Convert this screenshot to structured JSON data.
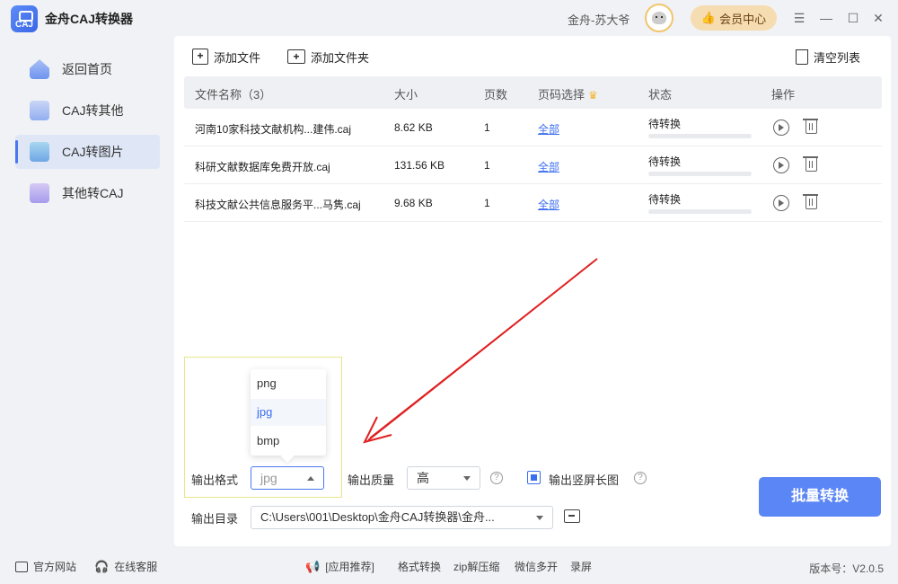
{
  "app": {
    "title": "金舟CAJ转换器",
    "logo_text": "CAJ",
    "username": "金舟-苏大爷",
    "vip_label": "会员中心"
  },
  "sidebar": {
    "items": [
      {
        "label": "返回首页",
        "icon": "home-icon"
      },
      {
        "label": "CAJ转其他",
        "icon": "caj-file-icon"
      },
      {
        "label": "CAJ转图片",
        "icon": "image-icon",
        "active": true
      },
      {
        "label": "其他转CAJ",
        "icon": "caj-convert-icon"
      }
    ]
  },
  "toolbar": {
    "add_file": "添加文件",
    "add_folder": "添加文件夹",
    "clear_list": "清空列表"
  },
  "table": {
    "headers": {
      "name": "文件名称（3）",
      "size": "大小",
      "pages": "页数",
      "page_select": "页码选择",
      "status": "状态",
      "actions": "操作"
    },
    "rows": [
      {
        "name": "河南10家科技文献机构...建伟.caj",
        "size": "8.62 KB",
        "pages": "1",
        "page_select": "全部",
        "status": "待转换"
      },
      {
        "name": "科研文献数据库免费开放.caj",
        "size": "131.56 KB",
        "pages": "1",
        "page_select": "全部",
        "status": "待转换"
      },
      {
        "name": "科技文献公共信息服务平...马隽.caj",
        "size": "9.68 KB",
        "pages": "1",
        "page_select": "全部",
        "status": "待转换"
      }
    ]
  },
  "output": {
    "format_label": "输出格式",
    "format_value": "jpg",
    "format_options": [
      "png",
      "jpg",
      "bmp"
    ],
    "quality_label": "输出质量",
    "quality_value": "高",
    "long_image_label": "输出竖屏长图",
    "long_image_checked": true,
    "dir_label": "输出目录",
    "dir_value": "C:\\Users\\001\\Desktop\\金舟CAJ转换器\\金舟..."
  },
  "convert_button": "批量转换",
  "footer": {
    "official_site": "官方网站",
    "online_service": "在线客服",
    "recommend": "[应用推荐]",
    "links": [
      "格式转换",
      "zip解压缩",
      "微信多开",
      "录屏"
    ],
    "version": "版本号：V2.0.5"
  },
  "colors": {
    "accent": "#5b86f5",
    "link": "#3a6ef0",
    "vip_bg": "#f6dcb1",
    "annotation_arrow": "#e02020"
  }
}
